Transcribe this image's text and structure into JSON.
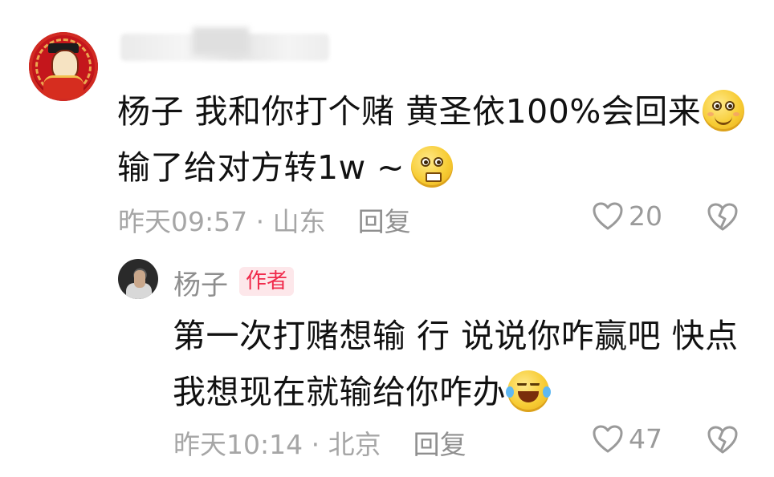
{
  "comment": {
    "username_label": "",
    "text_line1": "杨子 我和你打个赌 黄圣依100%会回来",
    "text_line2": "输了给对方转1w ~",
    "time_location": "昨天09:57 · 山东",
    "reply_label": "回复",
    "like_count": "20",
    "emoji_names": [
      "smile-emoji",
      "grin-emoji"
    ]
  },
  "reply": {
    "username": "杨子",
    "badge": "作者",
    "text_line1": "第一次打赌想输 行 说说你咋赢吧 快点",
    "text_line2": "我想现在就输给你咋办",
    "time_location": "昨天10:14 · 北京",
    "reply_label": "回复",
    "like_count": "47",
    "emoji_names": [
      "laugh-cry-emoji"
    ]
  },
  "colors": {
    "text": "#111111",
    "meta": "#a6a6a6",
    "badge_bg": "#fde7ea",
    "badge_text": "#f02a4b"
  }
}
